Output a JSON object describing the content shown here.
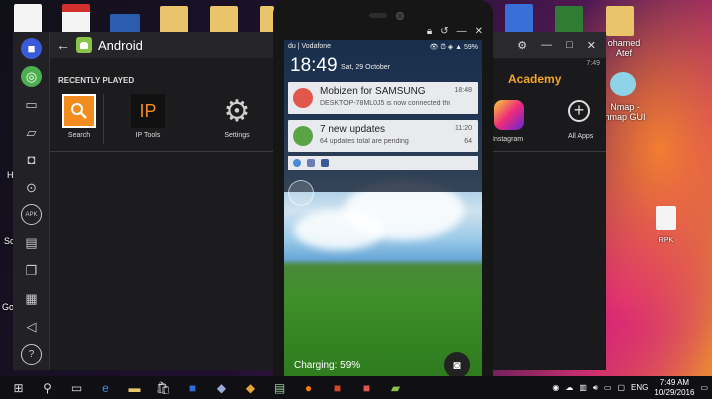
{
  "desktop": {
    "labels": {
      "mohamed": "ohamed\nAtef",
      "nmap": "Nmap -\nnmap GUI",
      "rpk": "RPK",
      "he": "H",
      "sc": "Sc",
      "go": "Go"
    }
  },
  "bluestacks": {
    "title": "Android",
    "recent_label": "RECENTLY PLAYED",
    "apps": [
      {
        "label": "Search"
      },
      {
        "label": "IP Tools",
        "glyph": "IP"
      },
      {
        "label": "Settings"
      }
    ],
    "side_buttons": [
      "video-icon",
      "chat-icon",
      "window-icon",
      "rotate-icon",
      "camera-icon",
      "location-icon",
      "apk-icon",
      "folder-icon",
      "copy-icon",
      "paste-icon",
      "volume-icon",
      "help-icon"
    ],
    "apk_text": "APK",
    "help_text": "?"
  },
  "right_window": {
    "academy": "Academy",
    "time": "7:49",
    "instagram_label": "Instagram",
    "allapps_label": "All Apps"
  },
  "phone": {
    "status": {
      "carrier": "du | Vodafone",
      "right": "59%"
    },
    "clock": "18:49",
    "date": "Sat, 29 October",
    "notifications": [
      {
        "title": "Mobizen for SAMSUNG",
        "text": "DESKTOP-78ML0J5 is now connected thro...",
        "time": "18:48",
        "count": ""
      },
      {
        "title": "7 new updates",
        "text": "64 updates total are pending",
        "time": "11:20",
        "count": "64"
      }
    ],
    "charging": "Charging: 59%"
  },
  "taskbar": {
    "lang": "ENG",
    "time": "7:49 AM",
    "date": "10/29/2016"
  },
  "colors": {
    "accent": "#ff8c1a",
    "bs_bg": "#1c1c1e"
  }
}
